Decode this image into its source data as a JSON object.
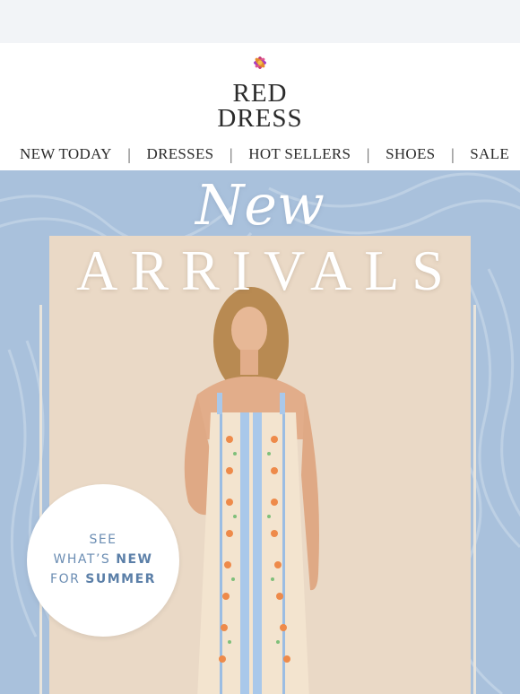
{
  "brand": {
    "name_line1": "RED",
    "name_line2": "DRESS",
    "logo_icon": "flower-logo-icon"
  },
  "nav": {
    "items": [
      {
        "label": "NEW TODAY"
      },
      {
        "label": "DRESSES"
      },
      {
        "label": "HOT SELLERS"
      },
      {
        "label": "SHOES"
      },
      {
        "label": "SALE"
      }
    ],
    "separator": "|"
  },
  "hero": {
    "title_script": "New",
    "title_main": "ARRIVALS",
    "cta": {
      "line1": "SEE",
      "line2_prefix": "WHAT’S",
      "line2_emph": "NEW",
      "line3_prefix": "FOR",
      "line3_emph": "SUMMER"
    }
  },
  "colors": {
    "hero_background": "#a9c1dc",
    "photo_background": "#ead9c6",
    "cta_text": "#6b8db3"
  }
}
